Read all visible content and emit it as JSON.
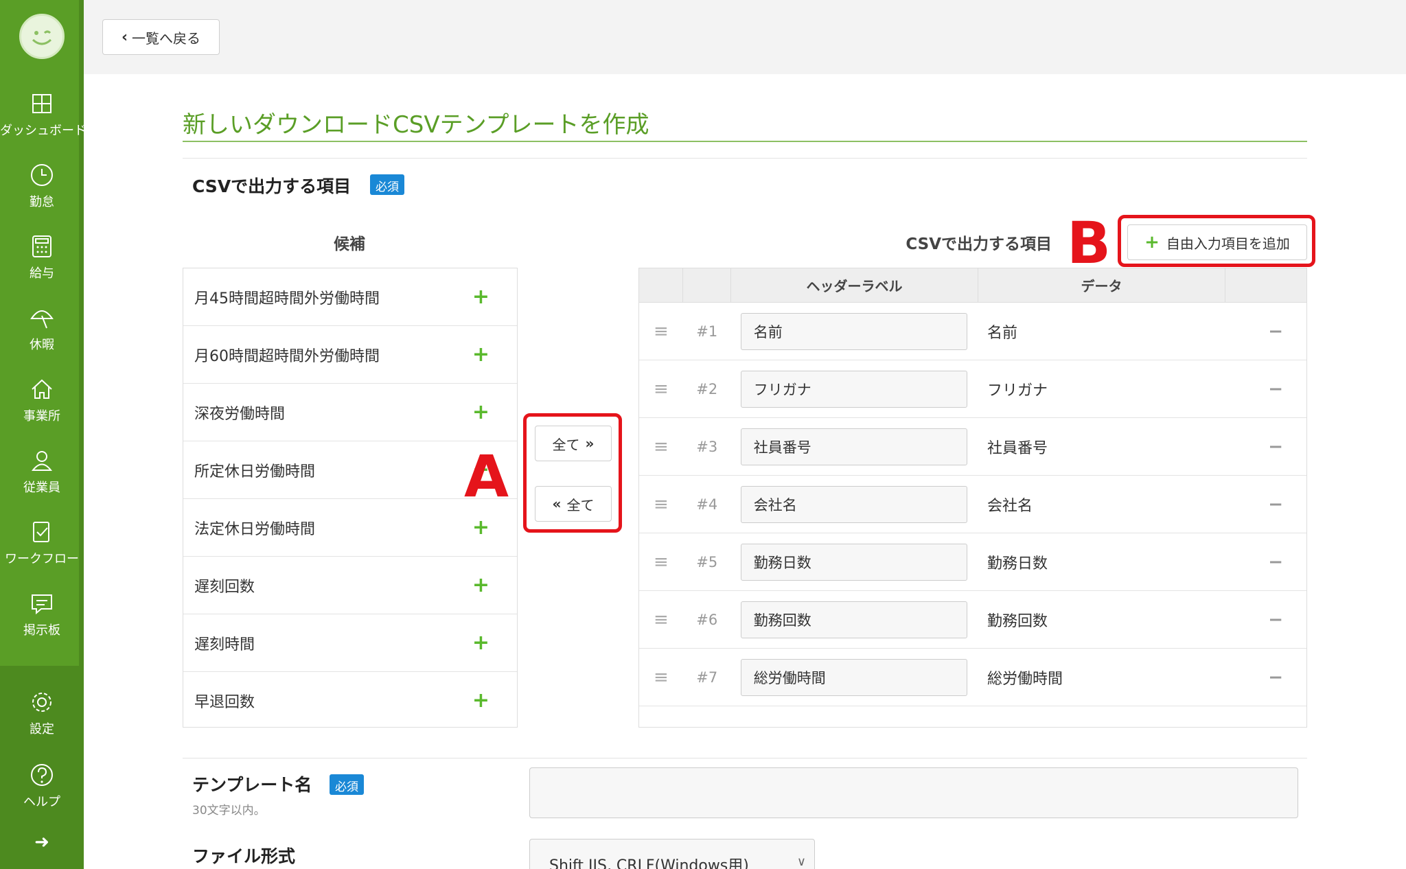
{
  "sidebar": {
    "items": [
      {
        "label": "ダッシュボード",
        "icon": "dashboard-icon"
      },
      {
        "label": "勤怠",
        "icon": "clock-icon"
      },
      {
        "label": "給与",
        "icon": "calculator-icon"
      },
      {
        "label": "休暇",
        "icon": "parasol-icon"
      },
      {
        "label": "事業所",
        "icon": "home-icon"
      },
      {
        "label": "従業員",
        "icon": "person-icon"
      },
      {
        "label": "ワークフロー",
        "icon": "checklist-icon"
      },
      {
        "label": "掲示板",
        "icon": "message-icon"
      }
    ],
    "settings_label": "設定",
    "help_label": "ヘルプ",
    "expand_glyph": "➜"
  },
  "topbar": {
    "back_label": "一覧へ戻る"
  },
  "page": {
    "title": "新しいダウンロードCSVテンプレートを作成"
  },
  "csv_section": {
    "label": "CSVで出力する項目",
    "required": "必須",
    "candidates_heading": "候補",
    "candidates": [
      "月45時間超時間外労働時間",
      "月60時間超時間外労働時間",
      "深夜労働時間",
      "所定休日労働時間",
      "法定休日労働時間",
      "遅刻回数",
      "遅刻時間",
      "早退回数"
    ],
    "plus_glyph": "+",
    "add_all_label": "全て",
    "remove_all_label": "全て",
    "output_heading": "CSVで出力する項目",
    "add_free_label": "自由入力項目を追加",
    "table_headers": {
      "header_label": "ヘッダーラベル",
      "data": "データ"
    },
    "rows": [
      {
        "num": "#1",
        "label": "名前",
        "data": "名前"
      },
      {
        "num": "#2",
        "label": "フリガナ",
        "data": "フリガナ"
      },
      {
        "num": "#3",
        "label": "社員番号",
        "data": "社員番号"
      },
      {
        "num": "#4",
        "label": "会社名",
        "data": "会社名"
      },
      {
        "num": "#5",
        "label": "勤務日数",
        "data": "勤務日数"
      },
      {
        "num": "#6",
        "label": "勤務回数",
        "data": "勤務回数"
      },
      {
        "num": "#7",
        "label": "総労働時間",
        "data": "総労働時間"
      }
    ]
  },
  "annotations": {
    "a": "A",
    "b": "B"
  },
  "template_name": {
    "label": "テンプレート名",
    "required": "必須",
    "hint": "30文字以内。",
    "value": ""
  },
  "file_format": {
    "label": "ファイル形式",
    "selected": "Shift JIS, CRLF(Windows用)"
  },
  "colors": {
    "brand_green": "#5a9e26",
    "badge_blue": "#1a88d6",
    "annotation_red": "#e5141b",
    "plus_green": "#5ab92d"
  }
}
